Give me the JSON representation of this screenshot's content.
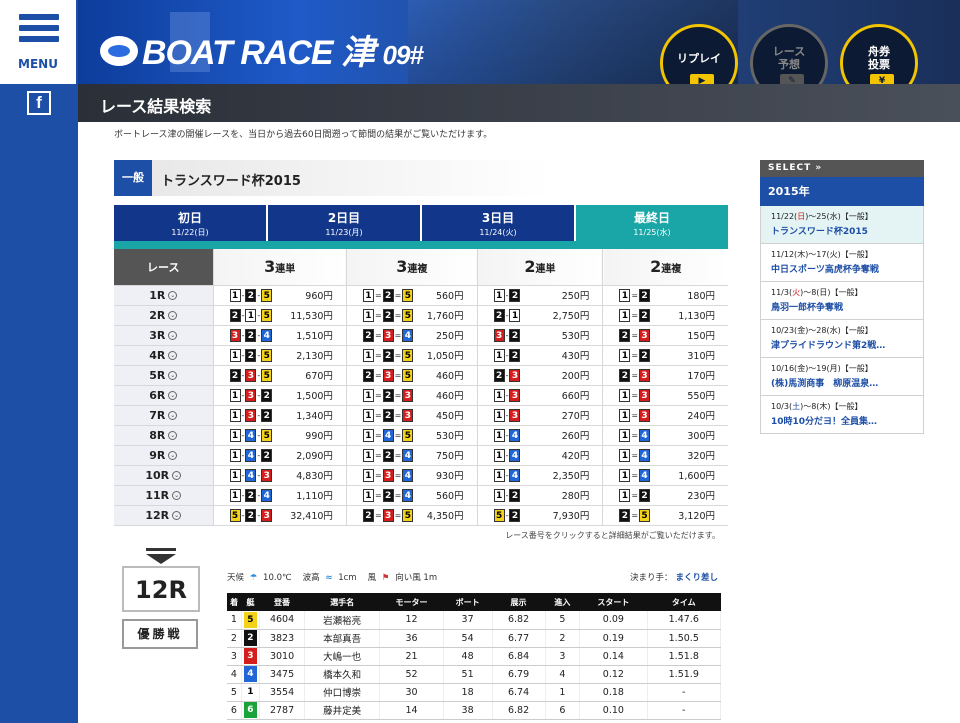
{
  "nav": {
    "menu_label": "MENU",
    "facebook_icon": "f"
  },
  "header": {
    "logo_text": "BOAT RACE 津",
    "logo_number": "09#",
    "replay": "リプレイ",
    "yoso_line1": "レース",
    "yoso_line2": "予想",
    "ticket_line1": "舟券",
    "ticket_line2": "投票"
  },
  "page": {
    "title": "レース結果検索",
    "description": "ボートレース津の開催レースを、当日から過去60日間遡って節間の結果がご覧いただけます。"
  },
  "race_series": {
    "category": "一般",
    "name": "トランスワード杯2015"
  },
  "tabs": [
    {
      "day": "初日",
      "date": "11/22(日)"
    },
    {
      "day": "2日目",
      "date": "11/23(月)"
    },
    {
      "day": "3日目",
      "date": "11/24(火)"
    },
    {
      "day": "最終日",
      "date": "11/25(水)"
    }
  ],
  "results_header": {
    "race": "レース",
    "g1_num": "3",
    "g1_label": "連単",
    "g2_num": "3",
    "g2_label": "連複",
    "g3_num": "2",
    "g3_label": "連単",
    "g4_num": "2",
    "g4_label": "連複"
  },
  "results": [
    {
      "race": "1R",
      "t3": [
        1,
        2,
        5
      ],
      "t3p": "960円",
      "f3": [
        1,
        2,
        5
      ],
      "f3p": "560円",
      "t2": [
        1,
        2
      ],
      "t2p": "250円",
      "f2": [
        1,
        2
      ],
      "f2p": "180円"
    },
    {
      "race": "2R",
      "t3": [
        2,
        1,
        5
      ],
      "t3p": "11,530円",
      "f3": [
        1,
        2,
        5
      ],
      "f3p": "1,760円",
      "t2": [
        2,
        1
      ],
      "t2p": "2,750円",
      "f2": [
        1,
        2
      ],
      "f2p": "1,130円"
    },
    {
      "race": "3R",
      "t3": [
        3,
        2,
        4
      ],
      "t3p": "1,510円",
      "f3": [
        2,
        3,
        4
      ],
      "f3p": "250円",
      "t2": [
        3,
        2
      ],
      "t2p": "530円",
      "f2": [
        2,
        3
      ],
      "f2p": "150円"
    },
    {
      "race": "4R",
      "t3": [
        1,
        2,
        5
      ],
      "t3p": "2,130円",
      "f3": [
        1,
        2,
        5
      ],
      "f3p": "1,050円",
      "t2": [
        1,
        2
      ],
      "t2p": "430円",
      "f2": [
        1,
        2
      ],
      "f2p": "310円"
    },
    {
      "race": "5R",
      "t3": [
        2,
        3,
        5
      ],
      "t3p": "670円",
      "f3": [
        2,
        3,
        5
      ],
      "f3p": "460円",
      "t2": [
        2,
        3
      ],
      "t2p": "200円",
      "f2": [
        2,
        3
      ],
      "f2p": "170円"
    },
    {
      "race": "6R",
      "t3": [
        1,
        3,
        2
      ],
      "t3p": "1,500円",
      "f3": [
        1,
        2,
        3
      ],
      "f3p": "460円",
      "t2": [
        1,
        3
      ],
      "t2p": "660円",
      "f2": [
        1,
        3
      ],
      "f2p": "550円"
    },
    {
      "race": "7R",
      "t3": [
        1,
        3,
        2
      ],
      "t3p": "1,340円",
      "f3": [
        1,
        2,
        3
      ],
      "f3p": "450円",
      "t2": [
        1,
        3
      ],
      "t2p": "270円",
      "f2": [
        1,
        3
      ],
      "f2p": "240円"
    },
    {
      "race": "8R",
      "t3": [
        1,
        4,
        5
      ],
      "t3p": "990円",
      "f3": [
        1,
        4,
        5
      ],
      "f3p": "530円",
      "t2": [
        1,
        4
      ],
      "t2p": "260円",
      "f2": [
        1,
        4
      ],
      "f2p": "300円"
    },
    {
      "race": "9R",
      "t3": [
        1,
        4,
        2
      ],
      "t3p": "2,090円",
      "f3": [
        1,
        2,
        4
      ],
      "f3p": "750円",
      "t2": [
        1,
        4
      ],
      "t2p": "420円",
      "f2": [
        1,
        4
      ],
      "f2p": "320円"
    },
    {
      "race": "10R",
      "t3": [
        1,
        4,
        3
      ],
      "t3p": "4,830円",
      "f3": [
        1,
        3,
        4
      ],
      "f3p": "930円",
      "t2": [
        1,
        4
      ],
      "t2p": "2,350円",
      "f2": [
        1,
        4
      ],
      "f2p": "1,600円"
    },
    {
      "race": "11R",
      "t3": [
        1,
        2,
        4
      ],
      "t3p": "1,110円",
      "f3": [
        1,
        2,
        4
      ],
      "f3p": "560円",
      "t2": [
        1,
        2
      ],
      "t2p": "280円",
      "f2": [
        1,
        2
      ],
      "f2p": "230円"
    },
    {
      "race": "12R",
      "t3": [
        5,
        2,
        3
      ],
      "t3p": "32,410円",
      "f3": [
        2,
        3,
        5
      ],
      "f3p": "4,350円",
      "t2": [
        5,
        2
      ],
      "t2p": "7,930円",
      "f2": [
        2,
        5
      ],
      "f2p": "3,120円"
    }
  ],
  "results_note": "レース番号をクリックすると詳細結果がご覧いただけます。",
  "race_detail": {
    "race_no": "12R",
    "race_kind": "優勝戦",
    "weather_label": "天候",
    "temp": "10.0℃",
    "wave_label": "波高",
    "wave": "1cm",
    "wind_label": "風",
    "wind": "向い風 1m",
    "kimarite_label": "決まり手：",
    "kimarite": "まくり差し",
    "columns": [
      "着",
      "艇",
      "登番",
      "選手名",
      "モーター",
      "ボート",
      "展示",
      "進入",
      "スタート",
      "タイム"
    ],
    "rows": [
      {
        "rank": "1",
        "boat": "5",
        "reg": "4604",
        "name": "岩瀬裕亮",
        "motor": "12",
        "boat_no": "37",
        "exh": "6.82",
        "entry": "5",
        "st": "0.09",
        "time": "1.47.6"
      },
      {
        "rank": "2",
        "boat": "2",
        "reg": "3823",
        "name": "本部真吾",
        "motor": "36",
        "boat_no": "54",
        "exh": "6.77",
        "entry": "2",
        "st": "0.19",
        "time": "1.50.5"
      },
      {
        "rank": "3",
        "boat": "3",
        "reg": "3010",
        "name": "大嶋一也",
        "motor": "21",
        "boat_no": "48",
        "exh": "6.84",
        "entry": "3",
        "st": "0.14",
        "time": "1.51.8"
      },
      {
        "rank": "4",
        "boat": "4",
        "reg": "3475",
        "name": "橋本久和",
        "motor": "52",
        "boat_no": "51",
        "exh": "6.79",
        "entry": "4",
        "st": "0.12",
        "time": "1.51.9"
      },
      {
        "rank": "5",
        "boat": "1",
        "reg": "3554",
        "name": "仲口博崇",
        "motor": "30",
        "boat_no": "18",
        "exh": "6.74",
        "entry": "1",
        "st": "0.18",
        "time": "-"
      },
      {
        "rank": "6",
        "boat": "6",
        "reg": "2787",
        "name": "藤井定美",
        "motor": "14",
        "boat_no": "38",
        "exh": "6.82",
        "entry": "6",
        "st": "0.10",
        "time": "-"
      }
    ]
  },
  "sidebar": {
    "select_label": "SELECT",
    "year": "2015年",
    "items": [
      {
        "d1": "11/22(",
        "dw1": "日",
        "d2": ")～25(水)【一般】",
        "title": "トランスワード杯2015",
        "w1": "red"
      },
      {
        "d1": "11/12(",
        "dw1": "木",
        "d2": ")～17(火)【一般】",
        "title": "中日スポーツ高虎杯争奪戦",
        "w1": ""
      },
      {
        "d1": "11/3(",
        "dw1": "火",
        "d2": ")～8(日)【一般】",
        "title": "鳥羽一郎杯争奪戦",
        "w1": "red"
      },
      {
        "d1": "10/23(",
        "dw1": "金",
        "d2": ")～28(水)【一般】",
        "title": "津プライドラウンド第2戦…",
        "w1": ""
      },
      {
        "d1": "10/16(",
        "dw1": "金",
        "d2": ")～19(月)【一般】",
        "title": "(株)馬渕商事　柳原温泉…",
        "w1": ""
      },
      {
        "d1": "10/3(",
        "dw1": "土",
        "d2": ")～8(木)【一般】",
        "title": "10時10分だヨ！全員集…",
        "w1": "blue"
      }
    ]
  },
  "colors": {
    "primary": "#1e4fa6",
    "teal": "#1aa6a6",
    "accent_yellow": "#f2c500"
  }
}
